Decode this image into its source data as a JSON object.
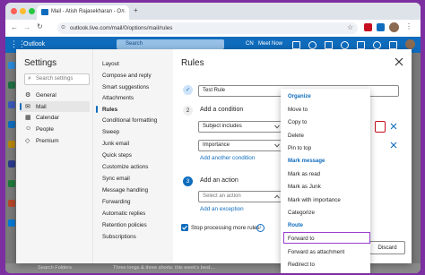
{
  "browser": {
    "tab_title": "Mail - Atish Rajasekharan - O...",
    "url": "outlook.live.com/mail/0/options/mail/rules"
  },
  "outlook": {
    "brand": "Outlook",
    "search_placeholder": "Search",
    "header_right": [
      "CN",
      "Meet Now"
    ]
  },
  "settings": {
    "title": "Settings",
    "search_placeholder": "Search settings",
    "nav": [
      {
        "label": "General",
        "icon": "gear-icon"
      },
      {
        "label": "Mail",
        "icon": "mail-icon"
      },
      {
        "label": "Calendar",
        "icon": "calendar-icon"
      },
      {
        "label": "People",
        "icon": "people-icon"
      },
      {
        "label": "Premium",
        "icon": "diamond-icon"
      }
    ],
    "mail_sections": [
      "Layout",
      "Compose and reply",
      "Smart suggestions",
      "Attachments",
      "Rules",
      "Conditional formatting",
      "Sweep",
      "Junk email",
      "Quick steps",
      "Customize actions",
      "Sync email",
      "Message handling",
      "Forwarding",
      "Automatic replies",
      "Retention policies",
      "Subscriptions"
    ]
  },
  "rules": {
    "title": "Rules",
    "rule_name": "Test Rule",
    "step2_label": "Add a condition",
    "condition1": "Subject includes",
    "condition2": "Importance",
    "add_condition_link": "Add another condition",
    "step3_label": "Add an action",
    "action_placeholder": "Select an action",
    "add_action_link": "Add an exception",
    "stop_processing": "Stop processing more rules",
    "discard": "Discard",
    "step_numbers": [
      "2",
      "3"
    ]
  },
  "dropdown": {
    "groups": [
      {
        "heading": "Organize",
        "items": [
          "Move to",
          "Copy to",
          "Delete",
          "Pin to top"
        ]
      },
      {
        "heading": "Mark message",
        "items": [
          "Mark as read",
          "Mark as Junk",
          "Mark with importance",
          "Categorize"
        ]
      },
      {
        "heading": "Route",
        "items": [
          "Forward to",
          "Forward as attachment",
          "Redirect to"
        ]
      }
    ]
  },
  "background": {
    "search_folders": "Search Folders",
    "snippet": "Three longs & three shorts: this week's best..."
  },
  "colors": {
    "outlook_blue": "#0f6cbd",
    "highlight": "#9b3fd0",
    "error_red": "#c50f1f"
  }
}
